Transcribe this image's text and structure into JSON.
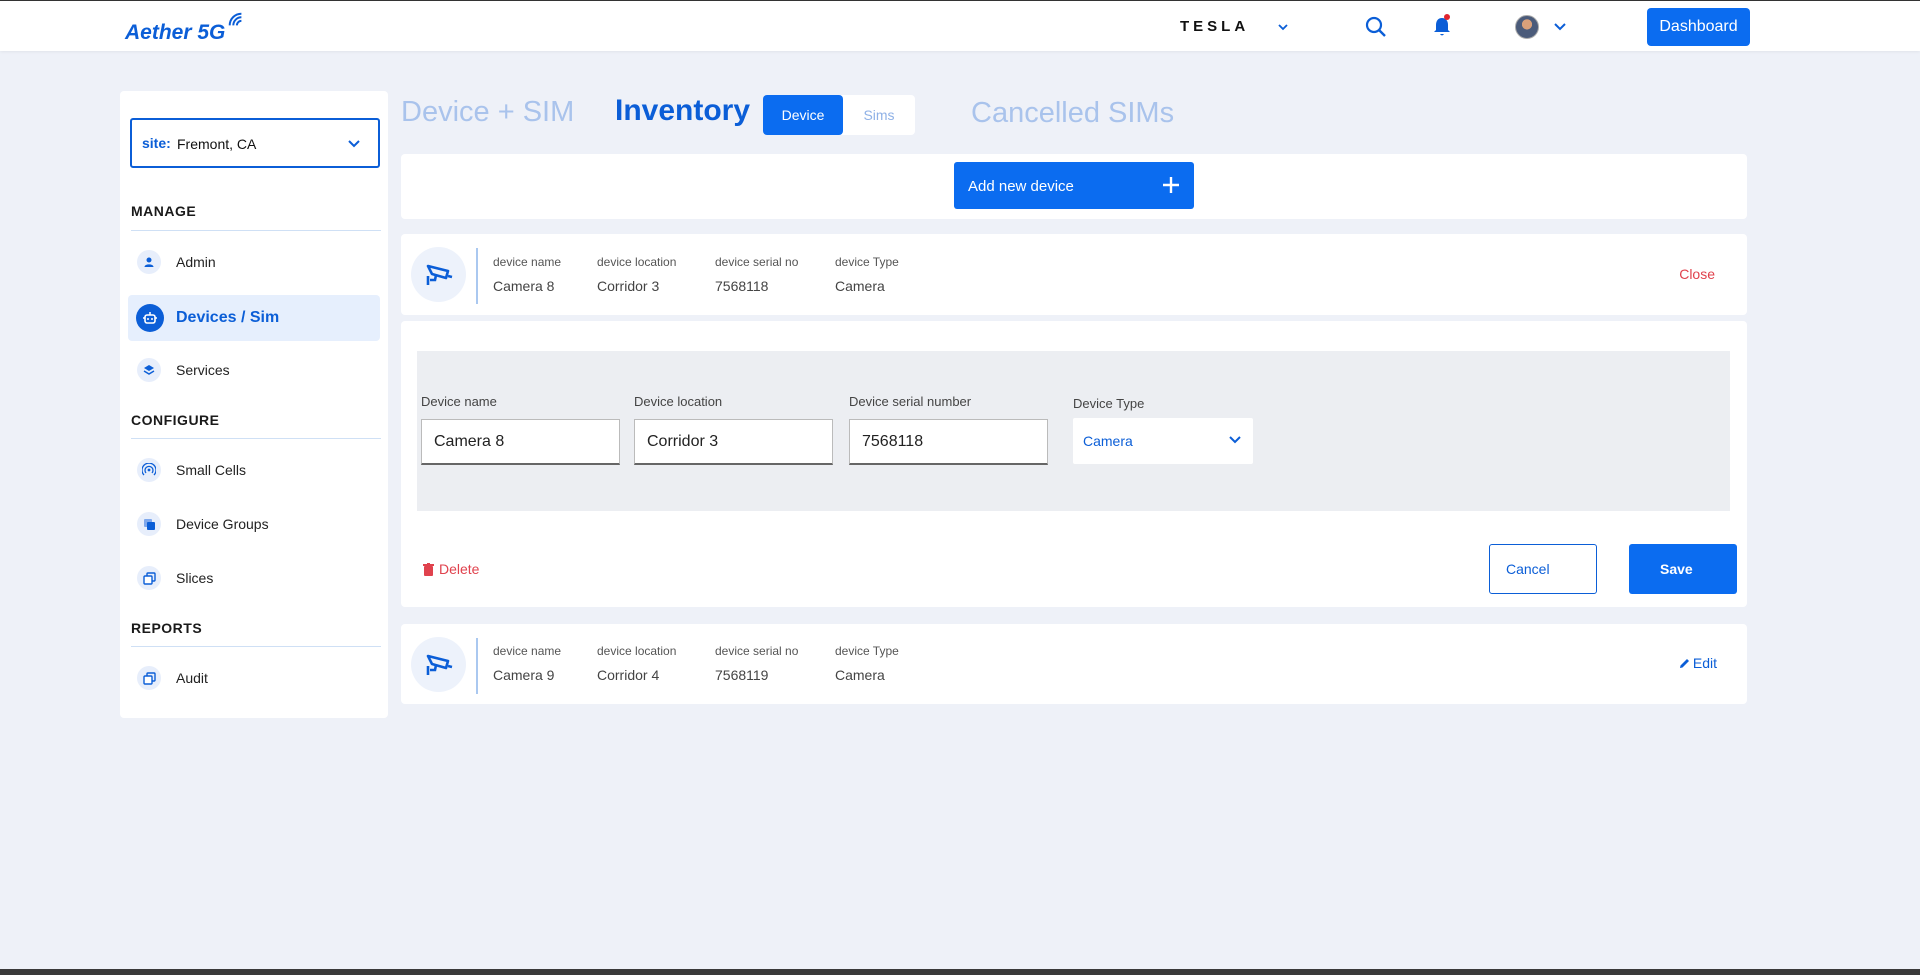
{
  "app": {
    "logo": "Aether 5G",
    "brand": "TESLA",
    "dashboard_label": "Dashboard"
  },
  "sidebar": {
    "site_label": "site:",
    "site_value": "Fremont, CA",
    "sections": [
      {
        "title": "MANAGE",
        "items": [
          {
            "label": "Admin",
            "icon": "user-icon"
          },
          {
            "label": "Devices / Sim",
            "icon": "robot-icon",
            "active": true
          },
          {
            "label": "Services",
            "icon": "layers-icon"
          }
        ]
      },
      {
        "title": "CONFIGURE",
        "items": [
          {
            "label": "Small Cells",
            "icon": "signal-icon"
          },
          {
            "label": "Device Groups",
            "icon": "copy-icon"
          },
          {
            "label": "Slices",
            "icon": "copy-icon"
          }
        ]
      },
      {
        "title": "REPORTS",
        "items": [
          {
            "label": "Audit",
            "icon": "copy-icon"
          }
        ]
      }
    ]
  },
  "tabs": {
    "device_sim": "Device + SIM",
    "inventory": "Inventory",
    "toggle_device": "Device",
    "toggle_sims": "Sims",
    "cancelled": "Cancelled SIMs"
  },
  "add_device_label": "Add new device",
  "field_labels": {
    "name": "device name",
    "location": "device location",
    "serial": "device serial no",
    "type": "device Type"
  },
  "devices": [
    {
      "name": "Camera 8",
      "location": "Corridor 3",
      "serial": "7568118",
      "type": "Camera",
      "action": "Close"
    },
    {
      "name": "Camera 9",
      "location": "Corridor 4",
      "serial": "7568119",
      "type": "Camera",
      "action": "Edit"
    }
  ],
  "edit_form": {
    "name_label": "Device name",
    "name_value": "Camera 8",
    "location_label": "Device location",
    "location_value": "Corridor 3",
    "serial_label": "Device serial number",
    "serial_value": "7568118",
    "type_label": "Device Type",
    "type_value": "Camera",
    "delete_label": "Delete",
    "cancel_label": "Cancel",
    "save_label": "Save"
  },
  "colors": {
    "primary": "#0b6cf0",
    "danger": "#e0424d",
    "background": "#eef1f8"
  }
}
